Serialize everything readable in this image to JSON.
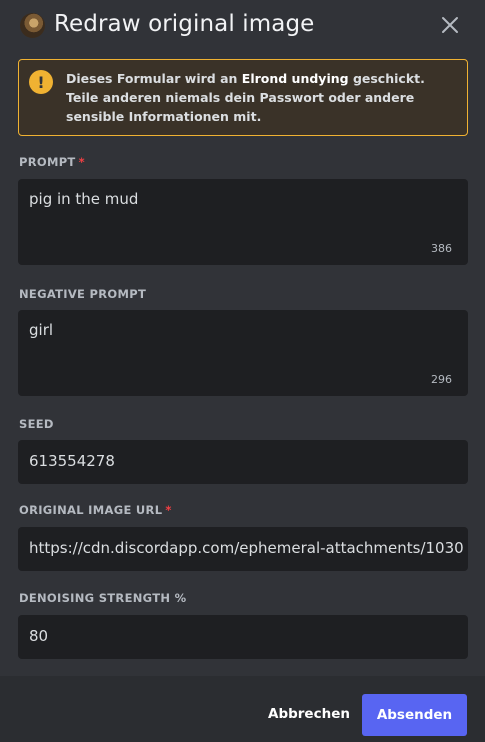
{
  "modal": {
    "title": "Redraw original image",
    "close_icon": "close-icon",
    "app_avatar": "app-avatar"
  },
  "notice": {
    "icon": "warning-icon",
    "icon_glyph": "!",
    "text_before": "Dieses Formular wird an ",
    "recipient": "Elrond undying",
    "text_after": " geschickt. Teile anderen niemals dein Passwort oder andere sensible Informationen mit."
  },
  "fields": {
    "prompt": {
      "label": "PROMPT",
      "required_mark": "*",
      "value": "pig in the mud",
      "counter": "386"
    },
    "negative_prompt": {
      "label": "NEGATIVE PROMPT",
      "value": "girl",
      "counter": "296"
    },
    "seed": {
      "label": "SEED",
      "value": "613554278"
    },
    "original_image_url": {
      "label": "ORIGINAL IMAGE URL",
      "required_mark": "*",
      "value": "https://cdn.discordapp.com/ephemeral-attachments/1030"
    },
    "denoising_strength": {
      "label": "DENOISING STRENGTH %",
      "value": "80"
    }
  },
  "footer": {
    "cancel_label": "Abbrechen",
    "submit_label": "Absenden"
  },
  "colors": {
    "background": "#313338",
    "input_background": "#1e1f22",
    "footer_background": "#2b2d31",
    "warning": "#f0b232",
    "required": "#f23f43",
    "brand": "#5865f2"
  }
}
